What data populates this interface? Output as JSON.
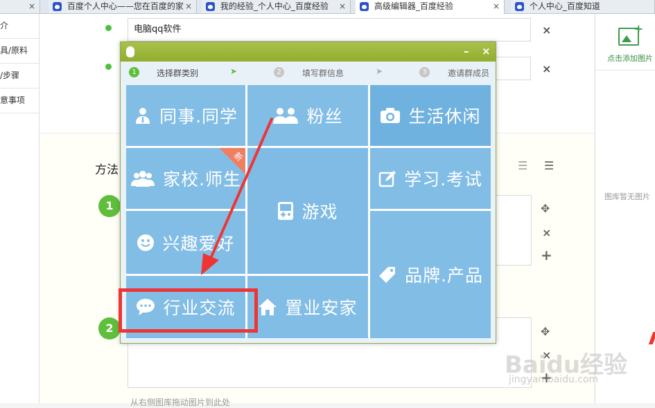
{
  "tabs": [
    {
      "label": "",
      "close": "×"
    },
    {
      "label": "百度个人中心——您在百度的家",
      "close": "×"
    },
    {
      "label": "我的经验_个人中心_百度经验",
      "close": "×"
    },
    {
      "label": "高级编辑器_百度经验",
      "close": "×",
      "active": true
    },
    {
      "label": "个人中心_百度知道",
      "close": ""
    }
  ],
  "sidebar": {
    "items": [
      "简介",
      "工具/原料",
      "方法/步骤",
      "注意事项"
    ]
  },
  "editor": {
    "tool_field_1": "电脑qq软件",
    "tool_field_2": "",
    "remove": "×",
    "method_title": "方法",
    "steps": [
      "1",
      "2"
    ],
    "move_icon": "✥",
    "add_icon": "+",
    "hint": "从右侧图库拖动图片到此处"
  },
  "right_panel": {
    "add_image": "点击添加图片",
    "no_image": "图库暂无图片"
  },
  "watermark": {
    "logo": "Baidu经验",
    "url": "jingyan.baidu.com"
  },
  "dialog": {
    "minimize": "–",
    "close": "×",
    "steps": [
      {
        "num": "1",
        "label": "选择群类别"
      },
      {
        "num": "2",
        "label": "填写群信息"
      },
      {
        "num": "3",
        "label": "邀请群成员"
      }
    ],
    "step_arrow": "➤",
    "categories": {
      "colleague": "同事.同学",
      "fans": "粉丝",
      "life": "生活休闲",
      "school": "家校.师生",
      "school_badge": "新",
      "game": "游戏",
      "study": "学习.考试",
      "interest": "兴趣爱好",
      "brand": "品牌.产品",
      "industry": "行业交流",
      "realestate": "置业安家"
    }
  },
  "colors": {
    "accent_green": "#5fbe3b",
    "dialog_title": "#9cb63c",
    "tile_blue": "#82bde6",
    "highlight_red": "#ee3535"
  }
}
